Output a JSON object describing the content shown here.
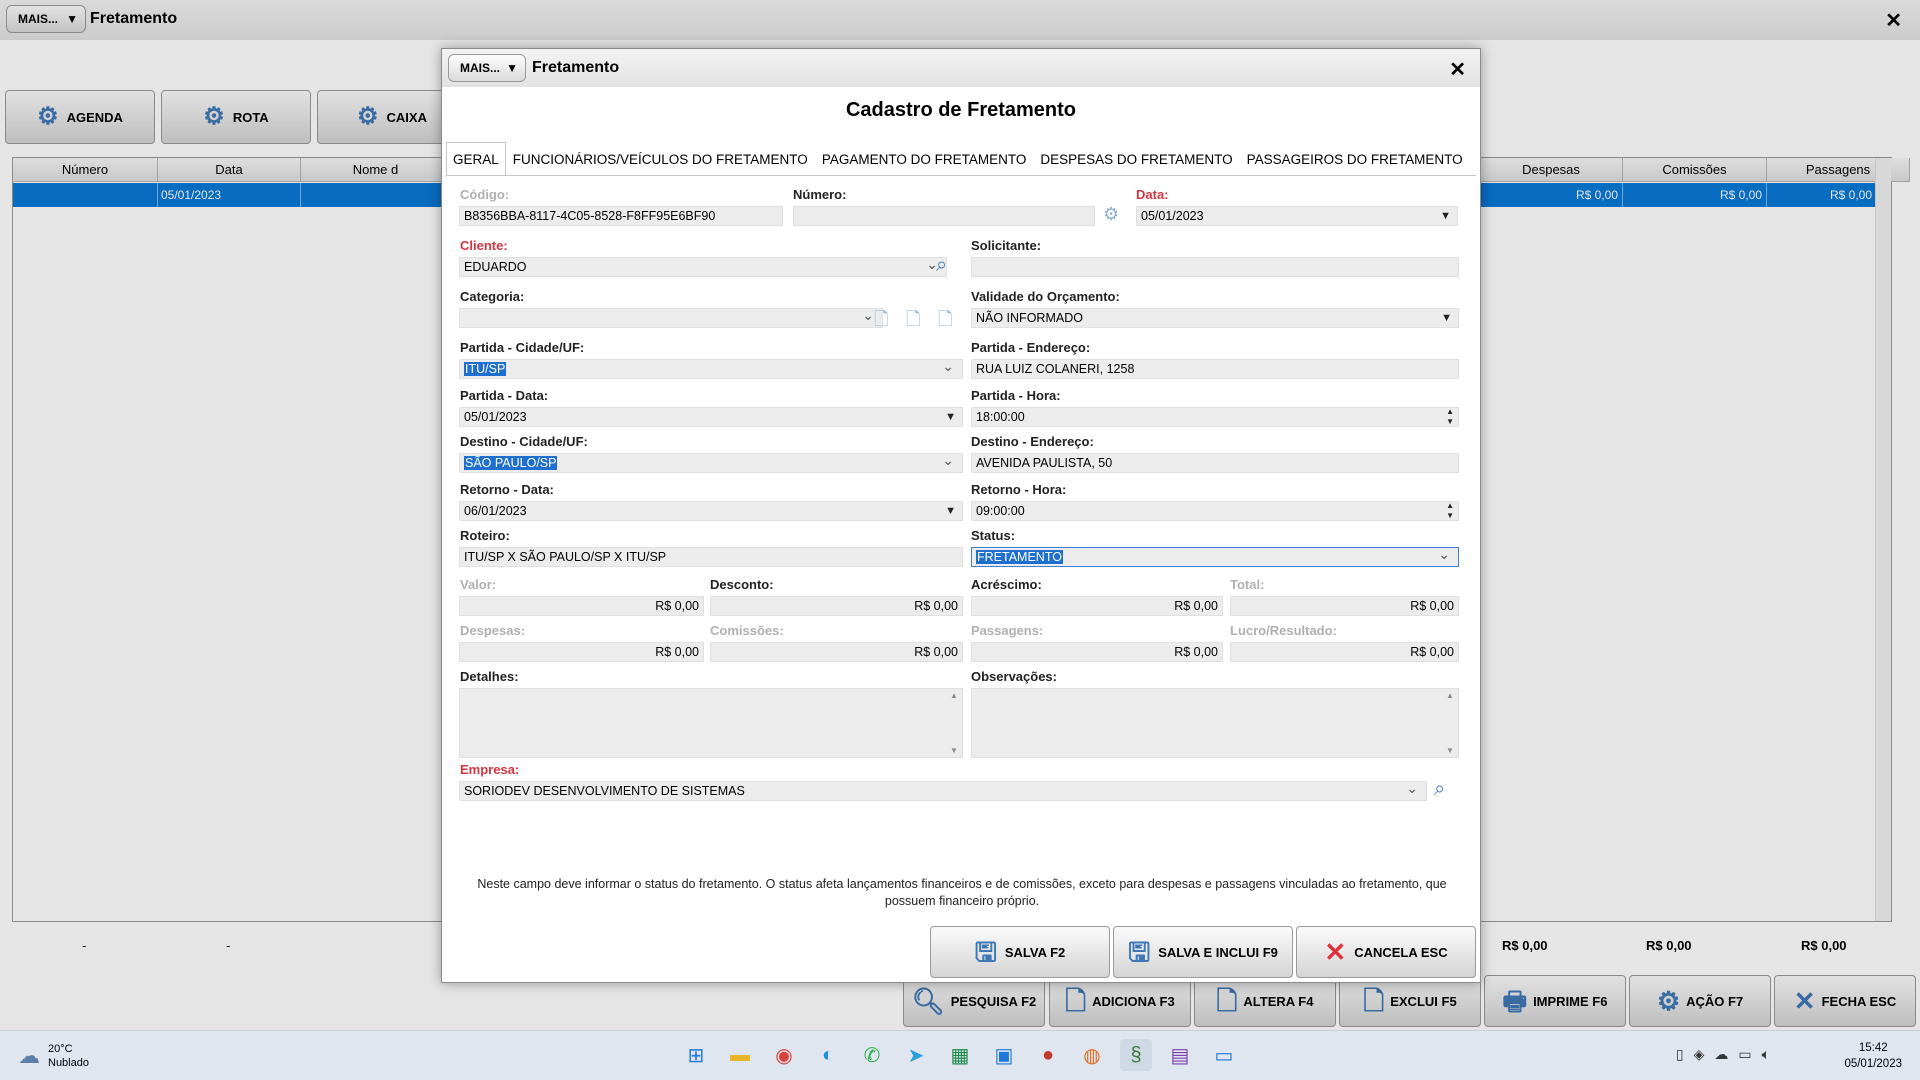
{
  "main_window": {
    "mais_label": "MAIS...",
    "title": "Fretamento",
    "close": "✕",
    "toolbar": [
      {
        "label": "AGENDA"
      },
      {
        "label": "ROTA"
      },
      {
        "label": "CAIXA"
      }
    ],
    "columns": [
      "Número",
      "Data",
      "Nome d",
      "Despesas",
      "Comissões",
      "Passagens"
    ],
    "row": {
      "numero": "",
      "data": "05/01/2023",
      "despesas": "R$ 0,00",
      "comissoes": "R$ 0,00",
      "passagens": "R$ 0,00"
    },
    "totals": {
      "dash1": "-",
      "dash2": "-",
      "despesas": "R$ 0,00",
      "comissoes": "R$ 0,00",
      "passagens": "R$ 0,00"
    },
    "bottom_buttons": [
      {
        "label": "PESQUISA F2"
      },
      {
        "label": "ADICIONA F3"
      },
      {
        "label": "ALTERA F4"
      },
      {
        "label": "EXCLUI F5"
      },
      {
        "label": "IMPRIME F6"
      },
      {
        "label": "AÇÃO F7"
      },
      {
        "label": "FECHA ESC"
      }
    ]
  },
  "modal": {
    "mais_label": "MAIS...",
    "title": "Fretamento",
    "close": "✕",
    "form_title": "Cadastro de Fretamento",
    "tabs": [
      {
        "label": "GERAL"
      },
      {
        "label": "FUNCIONÁRIOS/VEÍCULOS DO FRETAMENTO"
      },
      {
        "label": "PAGAMENTO DO FRETAMENTO"
      },
      {
        "label": "DESPESAS DO FRETAMENTO"
      },
      {
        "label": "PASSAGEIROS DO FRETAMENTO"
      }
    ],
    "fields": {
      "codigo_label": "Código:",
      "codigo": "B8356BBA-8117-4C05-8528-F8FF95E6BF90",
      "numero_label": "Número:",
      "numero": "",
      "data_label": "Data:",
      "data": "05/01/2023",
      "cliente_label": "Cliente:",
      "cliente": "EDUARDO",
      "solicitante_label": "Solicitante:",
      "solicitante": "",
      "categoria_label": "Categoria:",
      "categoria": "",
      "validade_label": "Validade do Orçamento:",
      "validade": "NÃO INFORMADO",
      "partida_cidade_label": "Partida - Cidade/UF:",
      "partida_cidade": "ITU/SP",
      "partida_endereco_label": "Partida - Endereço:",
      "partida_endereco": "RUA LUIZ COLANERI, 1258",
      "partida_data_label": "Partida - Data:",
      "partida_data": "05/01/2023",
      "partida_hora_label": "Partida - Hora:",
      "partida_hora": "18:00:00",
      "destino_cidade_label": "Destino - Cidade/UF:",
      "destino_cidade": "SÃO PAULO/SP",
      "destino_endereco_label": "Destino - Endereço:",
      "destino_endereco": "AVENIDA PAULISTA, 50",
      "retorno_data_label": "Retorno - Data:",
      "retorno_data": "06/01/2023",
      "retorno_hora_label": "Retorno - Hora:",
      "retorno_hora": "09:00:00",
      "roteiro_label": "Roteiro:",
      "roteiro": "ITU/SP X SÃO PAULO/SP X ITU/SP",
      "status_label": "Status:",
      "status": "FRETAMENTO",
      "valor_label": "Valor:",
      "valor": "R$ 0,00",
      "desconto_label": "Desconto:",
      "desconto": "R$ 0,00",
      "acrescimo_label": "Acréscimo:",
      "acrescimo": "R$ 0,00",
      "total_label": "Total:",
      "total": "R$ 0,00",
      "despesas_label": "Despesas:",
      "despesas": "R$ 0,00",
      "comissoes_label": "Comissões:",
      "comissoes": "R$ 0,00",
      "passagens_label": "Passagens:",
      "passagens": "R$ 0,00",
      "lucro_label": "Lucro/Resultado:",
      "lucro": "R$ 0,00",
      "detalhes_label": "Detalhes:",
      "observacoes_label": "Observações:",
      "empresa_label": "Empresa:",
      "empresa": "SORIODEV DESENVOLVIMENTO DE SISTEMAS"
    },
    "help_text": "Neste campo deve informar o status do fretamento. O status afeta lançamentos financeiros e de comissões, exceto para despesas e passagens vinculadas ao fretamento, que possuem financeiro próprio.",
    "actions": [
      {
        "label": "SALVA F2"
      },
      {
        "label": "SALVA E INCLUI F9"
      },
      {
        "label": "CANCELA ESC"
      }
    ]
  },
  "taskbar": {
    "temp": "20°C",
    "weather": "Nublado",
    "time": "15:42",
    "date": "05/01/2023"
  },
  "colors": {
    "accent": "#0a79d6",
    "required_label": "#d6353f",
    "selection": "#1e6fcf"
  }
}
